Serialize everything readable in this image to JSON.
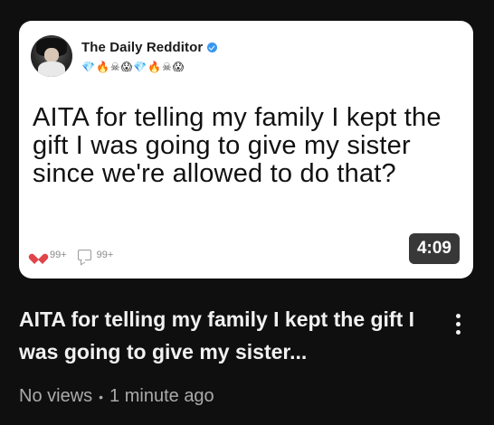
{
  "thumbnail": {
    "channel_name": "The Daily Redditor",
    "emoji_badges": "💎🔥☠😱💎🔥☠😱",
    "post_text": "AITA for telling my family I kept the gift I was going to give my sister since we're allowed to do that?",
    "likes": "99+",
    "comments": "99+",
    "duration": "4:09",
    "colors": {
      "card": "#ffffff",
      "heart": "#e0454a",
      "verified": "#3897f0"
    }
  },
  "video": {
    "title": "AITA for telling my family I kept the gift I was going to give my sister...",
    "views": "No views",
    "separator": "•",
    "age": "1 minute ago"
  },
  "icons": [
    "avatar",
    "verified-icon",
    "heart-icon",
    "comment-icon",
    "more-vert-icon"
  ]
}
